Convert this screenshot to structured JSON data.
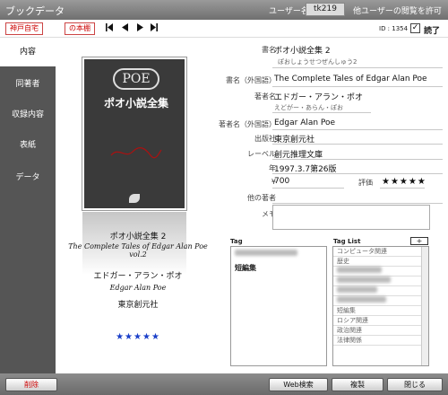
{
  "window": {
    "title": "ブックデータ"
  },
  "user": {
    "label": "ユーザー名",
    "name": "tk219",
    "other_users": "他ユーザーの閲覧を許可"
  },
  "toolbar": {
    "shelves": [
      "神戸自宅",
      "の本棚"
    ],
    "nav": [
      "first-icon",
      "prev-icon",
      "next-icon",
      "last-icon"
    ],
    "id_text": "ID : 1354",
    "read_label": "読了",
    "read_checked": true
  },
  "sidebar": {
    "tabs": [
      "内容",
      "同著者",
      "収録内容",
      "表紙",
      "データ"
    ],
    "active": 0
  },
  "cover": {
    "logo": "POE",
    "cover_title": "ポオ小説全集",
    "info_title": "ポオ小説全集 2",
    "info_en_title": "The Complete Tales of Edgar Alan Poe vol.2",
    "author": "エドガー・アラン・ポオ",
    "author_en": "Edgar Alan Poe",
    "publisher": "東京創元社",
    "stars": "★★★★★"
  },
  "form": {
    "labels": {
      "title": "書名",
      "title_foreign": "書名（外国語）",
      "author": "著者名",
      "author_foreign": "著者名（外国語）",
      "publisher": "出版社",
      "label": "レーベル",
      "year": "年",
      "price_symbol": "¥",
      "rating": "評価",
      "other_authors": "他の著者",
      "memo": "メモ"
    },
    "values": {
      "title": "ポオ小説全集 2",
      "title_kana": "ぽおしょうせつぜんしゅう2",
      "title_foreign": "The Complete Tales of Edgar Alan Poe",
      "author": "エドガー・アラン・ポオ",
      "author_kana": "えどがー・あらん・ぽお",
      "author_foreign": "Edgar Alan Poe",
      "publisher": "東京創元社",
      "label": "創元推理文庫",
      "year": "1997.3.7第26版",
      "price": "700",
      "rating": "★★★★★",
      "other_authors": "",
      "memo": ""
    }
  },
  "tags": {
    "tag_label": "Tag",
    "tag_list_label": "Tag List",
    "add_button": "+",
    "current": [
      "短編集"
    ],
    "list": [
      "コンピュータ関連",
      "歴史",
      "短編集",
      "ロシア関連",
      "政治関連",
      "法律関係"
    ]
  },
  "footer": {
    "delete": "削除",
    "web_search": "Web検索",
    "copy": "複製",
    "close": "閉じる"
  }
}
